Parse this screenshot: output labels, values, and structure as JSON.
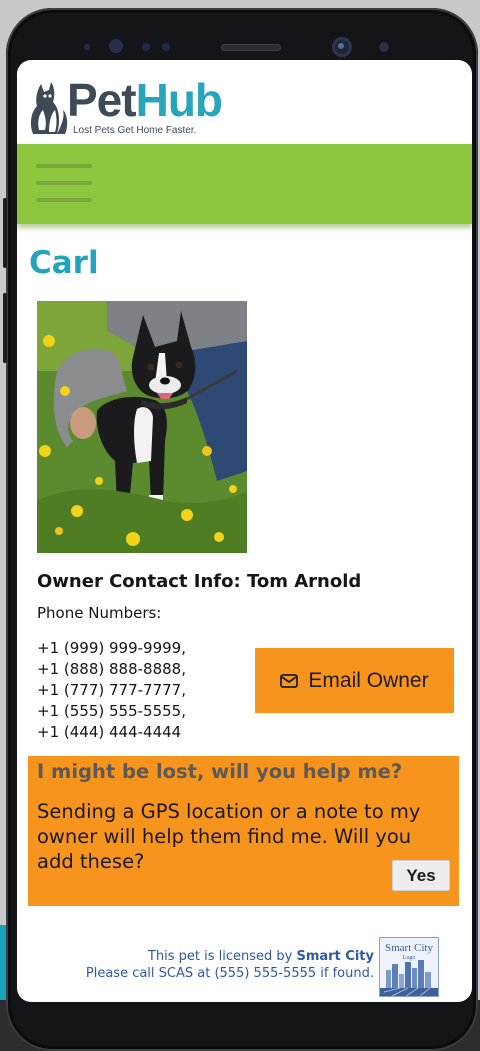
{
  "header": {
    "logo_pet": "Pet",
    "logo_hub": "Hub",
    "tagline": "Lost Pets Get Home Faster."
  },
  "pet": {
    "name": "Carl"
  },
  "owner": {
    "heading": "Owner Contact Info: Tom Arnold",
    "phones_label": "Phone Numbers:",
    "phones": [
      "+1 (999) 999-9999,",
      "+1 (888) 888-8888,",
      "+1 (777) 777-7777,",
      "+1 (555) 555-5555,",
      "+1 (444) 444-4444"
    ],
    "email_button": "Email Owner"
  },
  "lost": {
    "title": "I might be lost, will you help me?",
    "body": "Sending a GPS location or a note to my owner will help them find me. Will you add these?",
    "yes_button": "Yes"
  },
  "footer": {
    "license_prefix": "This pet is licensed by ",
    "license_org": "Smart City",
    "license_call": "Please call SCAS at (555) 555-5555 if found.",
    "city_logo_line1": "Smart City",
    "city_logo_line2": "Logo"
  },
  "colors": {
    "nav_green": "#8dc63f",
    "accent_orange": "#f7941d",
    "brand_teal": "#26a3bc",
    "brand_gray": "#3f4a57"
  },
  "icons": [
    "hamburger-menu-icon",
    "envelope-icon"
  ]
}
